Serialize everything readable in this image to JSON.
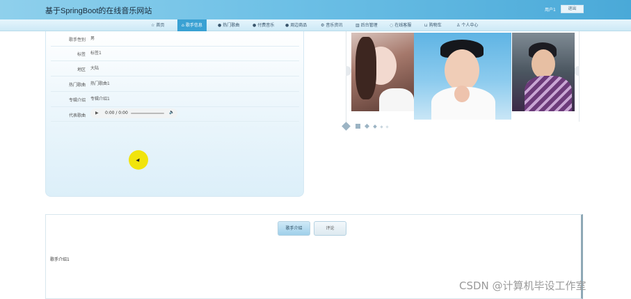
{
  "header": {
    "site_title": "基于SpringBoot的在线音乐网站",
    "user_label": "用户1",
    "logout_label": "退出"
  },
  "nav": {
    "items": [
      {
        "label": "首页",
        "icon": "star-icon",
        "active": false
      },
      {
        "label": "歌手信息",
        "icon": "home-icon",
        "active": true
      },
      {
        "label": "热门歌曲",
        "icon": "info-circle-icon",
        "active": false
      },
      {
        "label": "付费音乐",
        "icon": "info-circle-icon",
        "active": false
      },
      {
        "label": "周边商品",
        "icon": "info-circle-icon",
        "active": false
      },
      {
        "label": "音乐资讯",
        "icon": "gear-icon",
        "active": false
      },
      {
        "label": "后台管理",
        "icon": "building-icon",
        "active": false
      },
      {
        "label": "在线客服",
        "icon": "chat-icon",
        "active": false
      },
      {
        "label": "购物车",
        "icon": "cart-icon",
        "active": false
      },
      {
        "label": "个人中心",
        "icon": "person-icon",
        "active": false
      }
    ]
  },
  "singer_info": {
    "rows": [
      {
        "label": "歌手性别",
        "value": "男"
      },
      {
        "label": "标签",
        "value": "标签1"
      },
      {
        "label": "地区",
        "value": "大陆"
      },
      {
        "label": "热门歌曲",
        "value": "热门歌曲1"
      },
      {
        "label": "专辑介绍",
        "value": "专辑介绍1"
      }
    ],
    "audio_label": "代表歌曲",
    "audio_time": "0:00 / 0:00"
  },
  "tabs": {
    "intro_label": "歌手介绍",
    "comment_label": "评论"
  },
  "intro_text": "歌手介绍1",
  "watermark": "CSDN @计算机毕设工作室"
}
